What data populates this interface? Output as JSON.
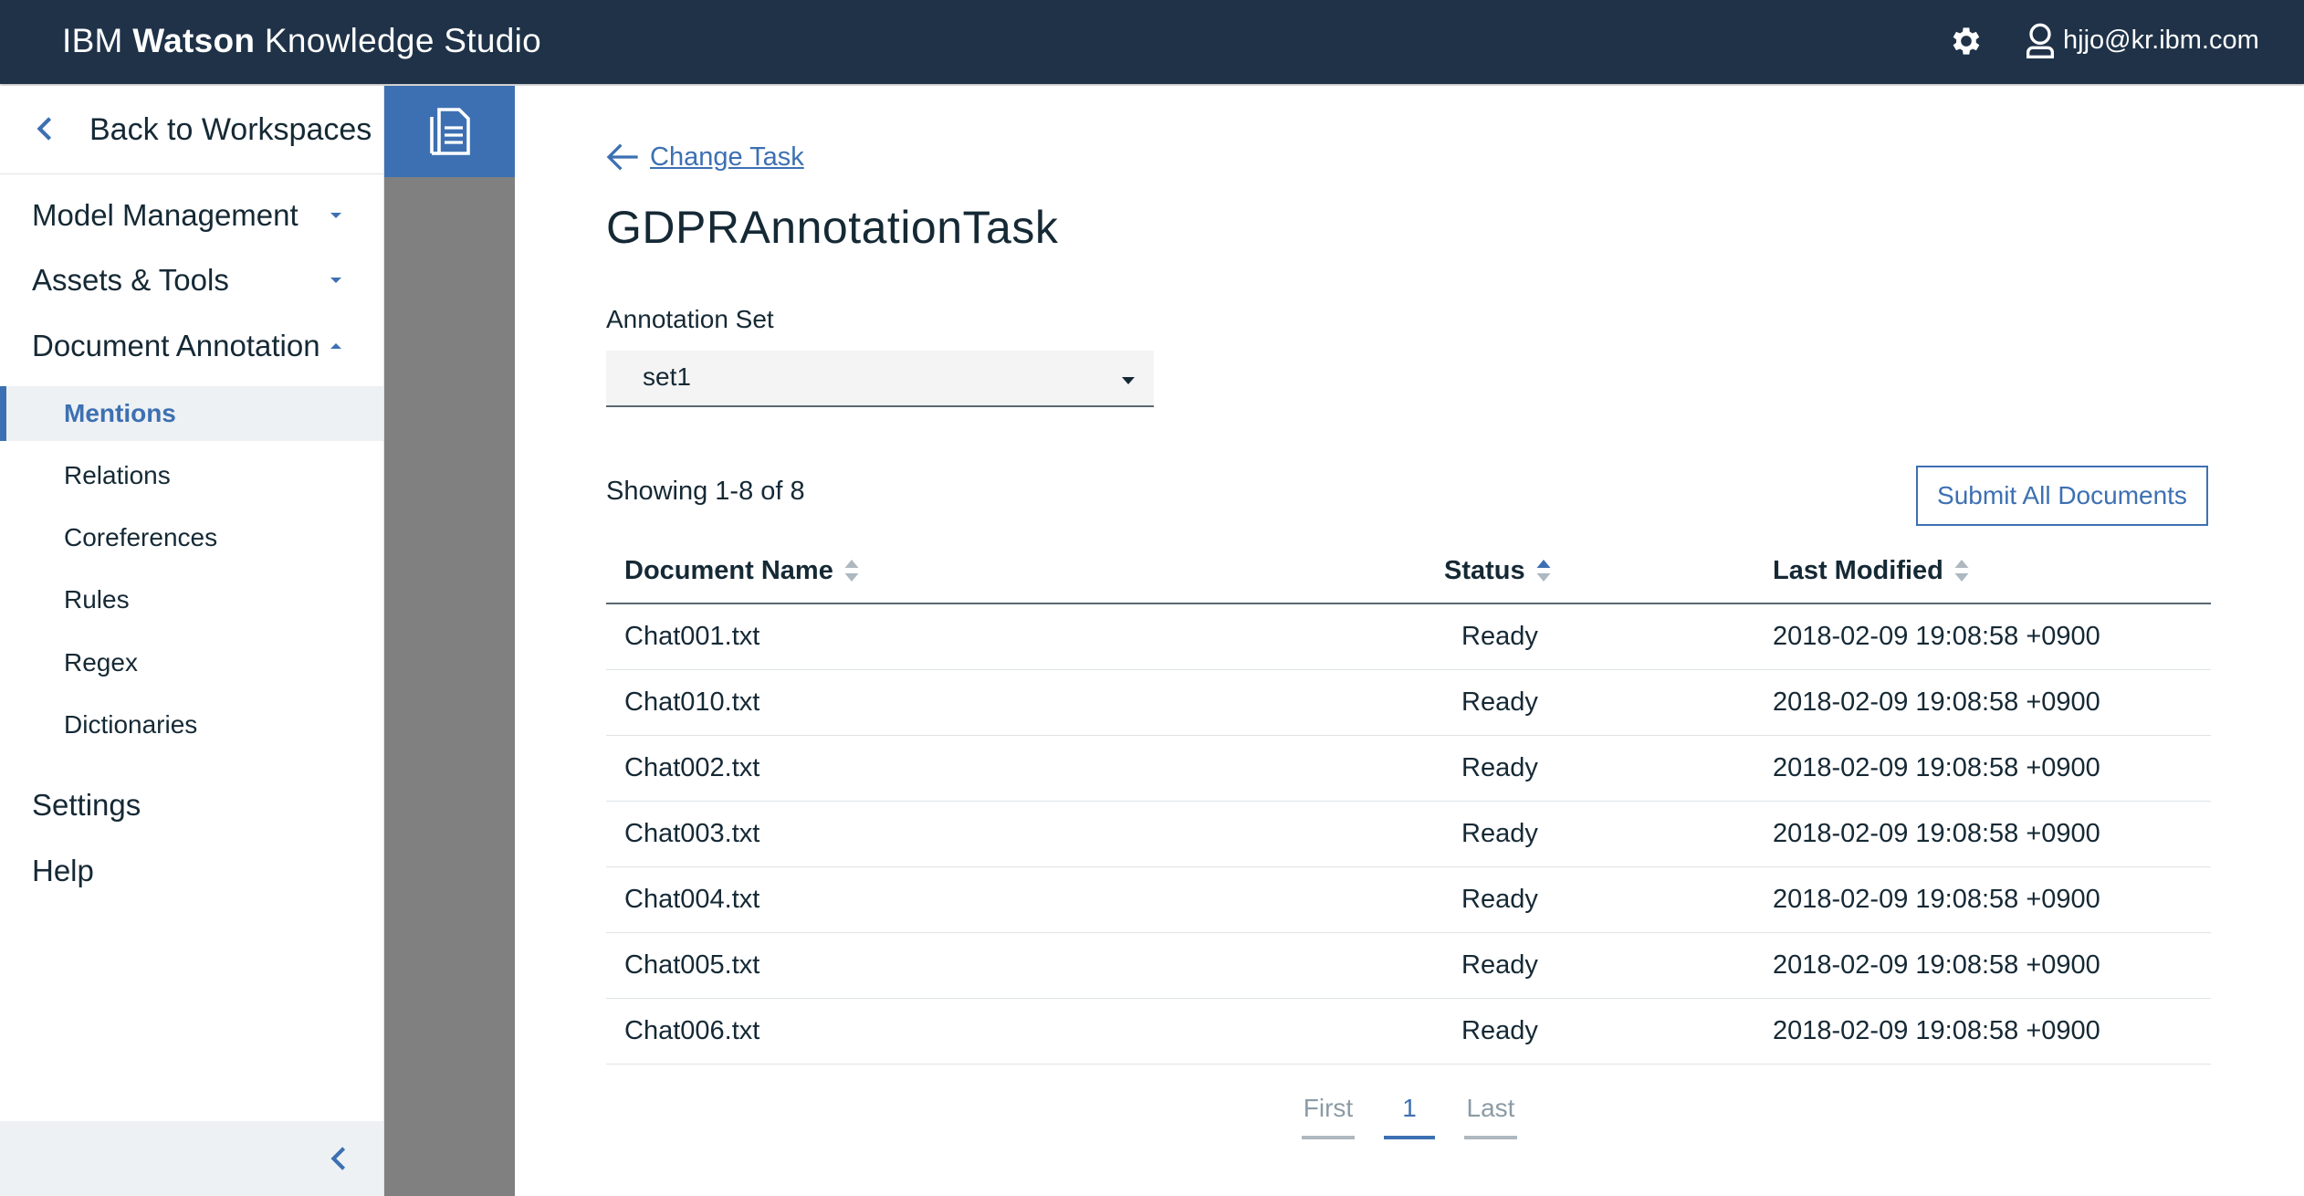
{
  "header": {
    "brand_prefix": "IBM",
    "brand_bold": "Watson",
    "brand_suffix": "Knowledge Studio",
    "settings_icon": "gear-icon",
    "user_icon": "user-icon",
    "user_email": "hjjo@kr.ibm.com",
    "background_color": "#1f3248"
  },
  "sidebar": {
    "back_label": "Back to Workspaces",
    "sections": [
      {
        "label": "Model Management",
        "state": "collapsed"
      },
      {
        "label": "Assets & Tools",
        "state": "collapsed"
      },
      {
        "label": "Document Annotation",
        "state": "expanded"
      }
    ],
    "sub_items": [
      {
        "label": "Mentions",
        "active": true
      },
      {
        "label": "Relations",
        "active": false
      },
      {
        "label": "Coreferences",
        "active": false
      },
      {
        "label": "Rules",
        "active": false
      },
      {
        "label": "Regex",
        "active": false
      },
      {
        "label": "Dictionaries",
        "active": false
      }
    ],
    "bottom_items": [
      {
        "label": "Settings"
      },
      {
        "label": "Help"
      }
    ],
    "accent_color": "#3d70b2"
  },
  "rail": {
    "icon": "document-icon"
  },
  "main": {
    "back_link": "Change Task",
    "title": "GDPRAnnotationTask",
    "annotation_set_label": "Annotation Set",
    "annotation_set_value": "set1",
    "showing": "Showing 1-8 of 8",
    "submit_label": "Submit All Documents",
    "columns": [
      "Document Name",
      "Status",
      "Last Modified"
    ],
    "rows": [
      {
        "name": "Chat001.txt",
        "status": "Ready",
        "modified": "2018-02-09 19:08:58 +0900"
      },
      {
        "name": "Chat010.txt",
        "status": "Ready",
        "modified": "2018-02-09 19:08:58 +0900"
      },
      {
        "name": "Chat002.txt",
        "status": "Ready",
        "modified": "2018-02-09 19:08:58 +0900"
      },
      {
        "name": "Chat003.txt",
        "status": "Ready",
        "modified": "2018-02-09 19:08:58 +0900"
      },
      {
        "name": "Chat004.txt",
        "status": "Ready",
        "modified": "2018-02-09 19:08:58 +0900"
      },
      {
        "name": "Chat005.txt",
        "status": "Ready",
        "modified": "2018-02-09 19:08:58 +0900"
      },
      {
        "name": "Chat006.txt",
        "status": "Ready",
        "modified": "2018-02-09 19:08:58 +0900"
      }
    ],
    "pagination": {
      "first": "First",
      "current": "1",
      "last": "Last"
    }
  }
}
